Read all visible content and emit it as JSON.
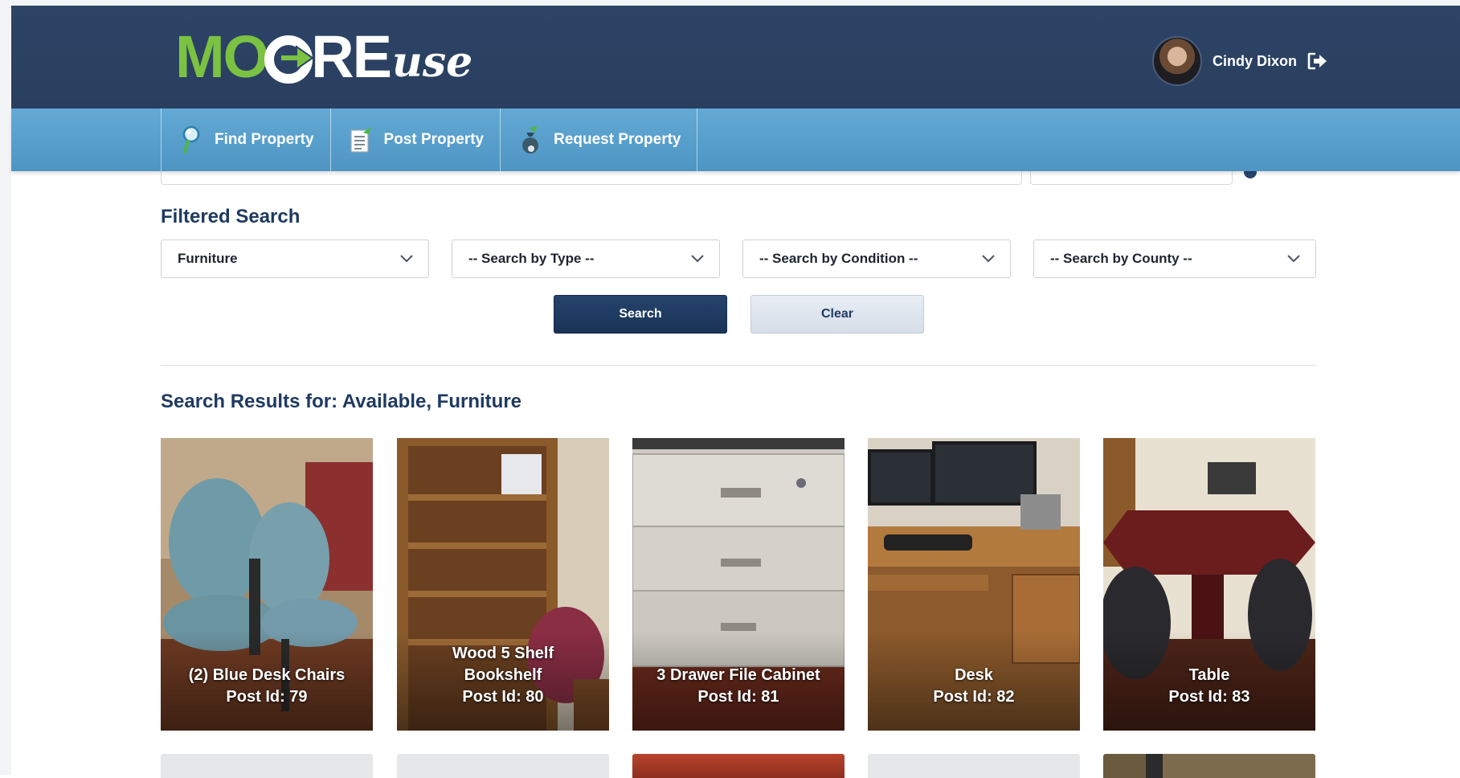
{
  "header": {
    "logo": {
      "part1": "MO",
      "part2": "RE",
      "part3": "use"
    },
    "user": {
      "name": "Cindy Dixon"
    }
  },
  "nav": {
    "items": [
      {
        "label": "Find Property"
      },
      {
        "label": "Post Property"
      },
      {
        "label": "Request Property"
      }
    ]
  },
  "filter": {
    "title": "Filtered Search",
    "selects": [
      {
        "value": "Furniture"
      },
      {
        "value": "-- Search by Type --"
      },
      {
        "value": "-- Search by Condition --"
      },
      {
        "value": "-- Search by County --"
      }
    ],
    "search_label": "Search",
    "clear_label": "Clear"
  },
  "results": {
    "title": "Search Results for: Available, Furniture",
    "items": [
      {
        "name": "(2) Blue Desk Chairs",
        "post_id": "Post Id: 79"
      },
      {
        "name": "Wood 5 Shelf Bookshelf",
        "post_id": "Post Id: 80"
      },
      {
        "name": "3 Drawer File Cabinet",
        "post_id": "Post Id: 81"
      },
      {
        "name": "Desk",
        "post_id": "Post Id: 82"
      },
      {
        "name": "Table",
        "post_id": "Post Id: 83"
      }
    ]
  },
  "colors": {
    "header_bg": "#2d4467",
    "nav_bg": "#5aa1cf",
    "logo_green": "#7cc242",
    "title_blue": "#1f3a60",
    "search_button": "#1f3a60"
  }
}
